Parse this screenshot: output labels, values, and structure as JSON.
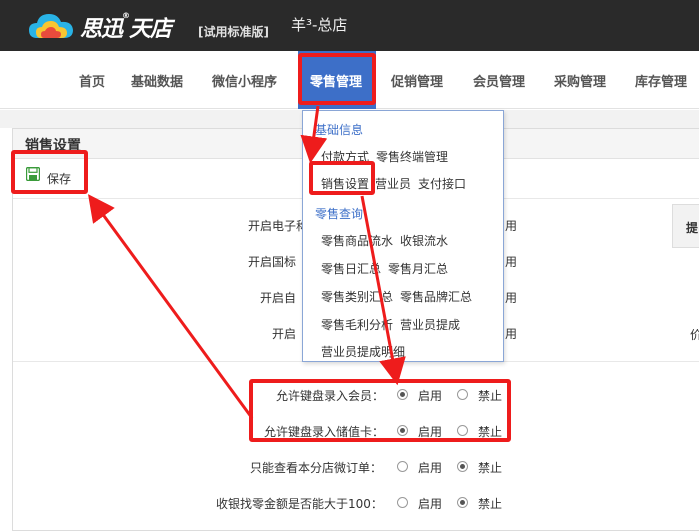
{
  "header": {
    "logo_text": "思迅",
    "logo_reg": "®",
    "product": "天店",
    "edition": "[试用标准版]",
    "store": "羊³-总店"
  },
  "nav": {
    "items": [
      "首页",
      "基础数据",
      "微信小程序",
      "零售管理",
      "促销管理",
      "会员管理",
      "采购管理",
      "库存管理"
    ],
    "active_index": 3
  },
  "panel": {
    "title": "销售设置",
    "save_label": "保存"
  },
  "form_top": [
    {
      "label": "开启电子称",
      "value": "用"
    },
    {
      "label": "开启国标",
      "value": "用"
    },
    {
      "label": "开启自",
      "value": "用"
    },
    {
      "label": "开启",
      "value": "用"
    }
  ],
  "form_bottom": [
    {
      "label": "允许键盘录入会员：",
      "options": [
        "启用",
        "禁止"
      ],
      "selected": 0
    },
    {
      "label": "允许键盘录入储值卡：",
      "options": [
        "启用",
        "禁止"
      ],
      "selected": 0
    },
    {
      "label": "只能查看本分店微订单：",
      "options": [
        "启用",
        "禁止"
      ],
      "selected": 1
    },
    {
      "label": "收银找零金额是否能大于100：",
      "options": [
        "启用",
        "禁止"
      ],
      "selected": 1
    }
  ],
  "right_side": {
    "box_char": "提",
    "char": "价"
  },
  "dropdown": {
    "group1": "基础信息",
    "row1": [
      "付款方式",
      "零售终端管理"
    ],
    "row2": [
      "销售设置",
      "营业员",
      "支付接口"
    ],
    "group2": "零售查询",
    "row3": [
      "零售商品流水",
      "收银流水"
    ],
    "row4": [
      "零售日汇总",
      "零售月汇总"
    ],
    "row5": [
      "零售类别汇总",
      "零售品牌汇总"
    ],
    "row6": [
      "零售毛利分析",
      "营业员提成"
    ],
    "row7": [
      "营业员提成明细"
    ]
  },
  "colors": {
    "topbar": "#2a2a2a",
    "accent": "#3d6fc8",
    "annotation": "#ee1c1c"
  }
}
